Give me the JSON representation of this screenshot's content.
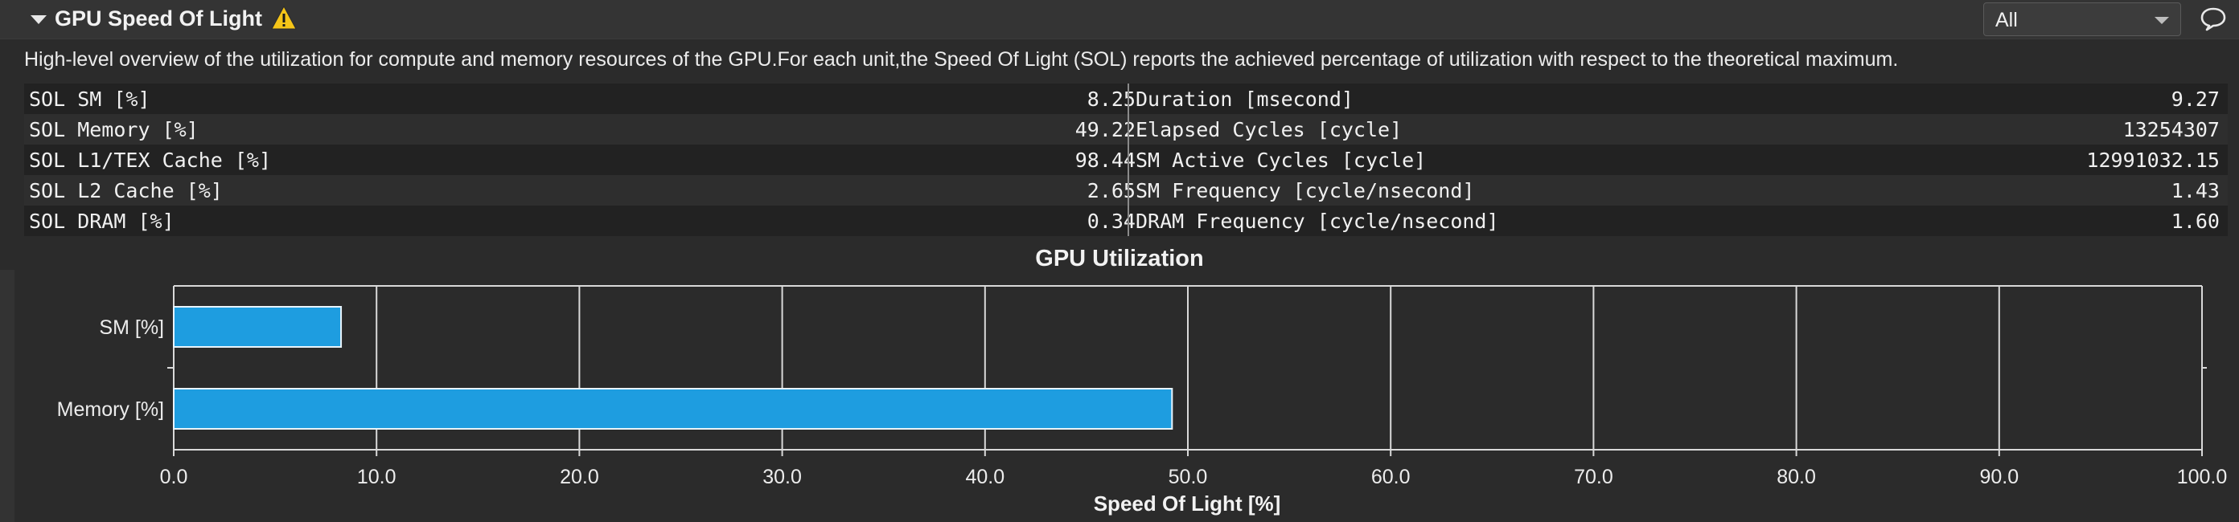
{
  "header": {
    "title": "GPU Speed Of Light",
    "warning_icon": "warning-triangle-icon",
    "filter_value": "All",
    "comment_icon": "comment-bubble-icon"
  },
  "description": "High-level overview of the utilization for compute and memory resources of the GPU.For each unit,the Speed Of Light (SOL) reports the achieved percentage of utilization with respect to the theoretical maximum.",
  "metrics": [
    {
      "left_label": "SOL SM [%]",
      "left_value": "8.25",
      "right_label": "Duration [msecond]",
      "right_value": "9.27"
    },
    {
      "left_label": "SOL Memory [%]",
      "left_value": "49.22",
      "right_label": "Elapsed Cycles [cycle]",
      "right_value": "13254307"
    },
    {
      "left_label": "SOL L1/TEX Cache [%]",
      "left_value": "98.44",
      "right_label": "SM Active Cycles [cycle]",
      "right_value": "12991032.15"
    },
    {
      "left_label": "SOL L2 Cache [%]",
      "left_value": "2.65",
      "right_label": "SM Frequency [cycle/nsecond]",
      "right_value": "1.43"
    },
    {
      "left_label": "SOL DRAM [%]",
      "left_value": "0.34",
      "right_label": "DRAM Frequency [cycle/nsecond]",
      "right_value": "1.60"
    }
  ],
  "colors": {
    "bar_fill": "#1e9de0",
    "bar_stroke": "#e8f4fc",
    "grid": "#d9d9d9",
    "warning": "#f5c518"
  },
  "chart_data": {
    "type": "bar",
    "orientation": "horizontal",
    "title": "GPU Utilization",
    "xlabel": "Speed Of Light [%]",
    "categories": [
      "SM [%]",
      "Memory [%]"
    ],
    "values": [
      8.25,
      49.22
    ],
    "xlim": [
      0,
      100
    ],
    "x_ticks": [
      "0.0",
      "10.0",
      "20.0",
      "30.0",
      "40.0",
      "50.0",
      "60.0",
      "70.0",
      "80.0",
      "90.0",
      "100.0"
    ],
    "grid": true
  }
}
